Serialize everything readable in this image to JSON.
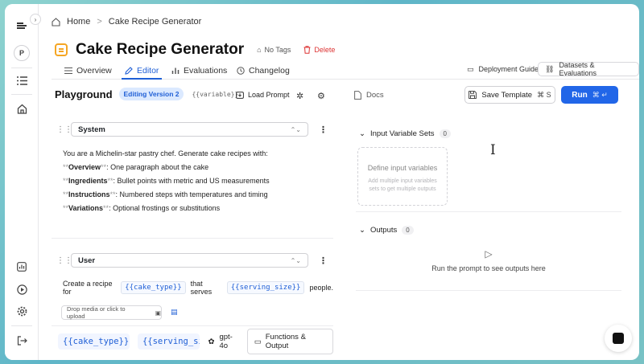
{
  "breadcrumb": {
    "home": "Home",
    "separator": ">",
    "current": "Cake Recipe Generator"
  },
  "rail": {
    "avatar": "P"
  },
  "header": {
    "title": "Cake Recipe Generator",
    "no_tags": "No Tags",
    "delete": "Delete"
  },
  "tabs": [
    {
      "label": "Overview"
    },
    {
      "label": "Editor"
    },
    {
      "label": "Evaluations"
    },
    {
      "label": "Changelog"
    }
  ],
  "top_links": {
    "deployment": "Deployment Guide",
    "datasets": "Datasets & Evaluations"
  },
  "playground": {
    "title": "Playground",
    "badge": "Editing Version 2",
    "var_hint": "{{variable}}",
    "load_prompt": "Load Prompt",
    "docs": "Docs",
    "save": "Save Template",
    "save_kbd": "⌘ S",
    "run": "Run",
    "run_kbd": "⌘ ↵"
  },
  "system": {
    "role": "System",
    "line1": "You are a Michelin-star pastry chef. Generate cake recipes with:",
    "mark": "**",
    "items": [
      {
        "bold": "Overview",
        "rest": ": One paragraph about the cake"
      },
      {
        "bold": "Ingredients",
        "rest": ": Bullet points with metric and US measurements"
      },
      {
        "bold": "Instructions",
        "rest": ": Numbered steps with temperatures and timing"
      },
      {
        "bold": "Variations",
        "rest": ": Optional frostings or substitutions"
      }
    ]
  },
  "user": {
    "role": "User",
    "pre": "Create a recipe for",
    "var1": "{{cake_type}}",
    "mid": "that serves",
    "var2": "{{serving_size}}",
    "post": "people.",
    "drop": "Drop media or click to upload"
  },
  "bottom": {
    "var1": "{{cake_type}}",
    "var2": "{{serving_size}}",
    "model": "gpt-4o",
    "functions": "Functions & Output"
  },
  "inputs": {
    "title": "Input Variable Sets",
    "count": "0",
    "define": "Define input variables",
    "define_hint": "Add multiple input variables sets to get multiple outputs"
  },
  "outputs": {
    "title": "Outputs",
    "count": "0",
    "empty": "Run the prompt to see outputs here"
  }
}
